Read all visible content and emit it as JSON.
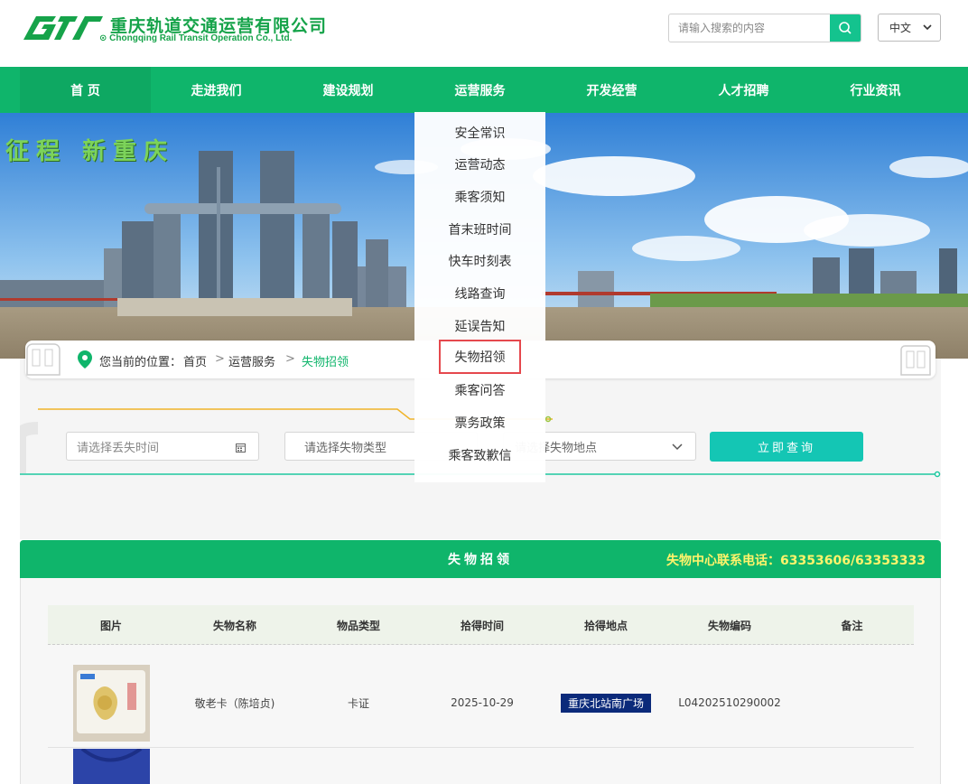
{
  "header": {
    "company_cn": "重庆轨道交通运营有限公司",
    "company_en": "Chongqing Rail Transit Operation Co., Ltd.",
    "search_placeholder": "请输入搜索的内容",
    "language": "中文",
    "brand_color": "#0fb56b"
  },
  "nav": {
    "items": [
      "首 页",
      "走进我们",
      "建设规划",
      "运营服务",
      "开发经营",
      "人才招聘",
      "行业资讯"
    ],
    "active_index": 0,
    "open_index": 3
  },
  "banner": {
    "slogan": "征程 新重庆"
  },
  "dropdown": {
    "items": [
      "安全常识",
      "运营动态",
      "乘客须知",
      "首末班时间",
      "快车时刻表",
      "线路查询",
      "延误告知",
      "失物招领",
      "乘客问答",
      "票务政策",
      "乘客致歉信"
    ],
    "highlighted": "失物招领"
  },
  "breadcrumb": {
    "prefix": "您当前的位置：",
    "home": "首页",
    "section": "运营服务",
    "current": "失物招领",
    "separator": ">"
  },
  "filters": {
    "date_placeholder": "请选择丢失时间",
    "type_placeholder": "请选择失物类型",
    "location_placeholder": "请选择失物地点",
    "query_button": "立即查询"
  },
  "panel": {
    "title": "失物招领",
    "phone": "失物中心联系电话：63353606/63353333"
  },
  "table": {
    "headers": [
      "图片",
      "失物名称",
      "物品类型",
      "拾得时间",
      "拾得地点",
      "失物编码",
      "备注"
    ],
    "rows": [
      {
        "name": "敬老卡（陈培贞)",
        "type": "卡证",
        "date": "2025-10-29",
        "location": "重庆北站南广场",
        "code": "L04202510290002",
        "note": ""
      }
    ]
  }
}
